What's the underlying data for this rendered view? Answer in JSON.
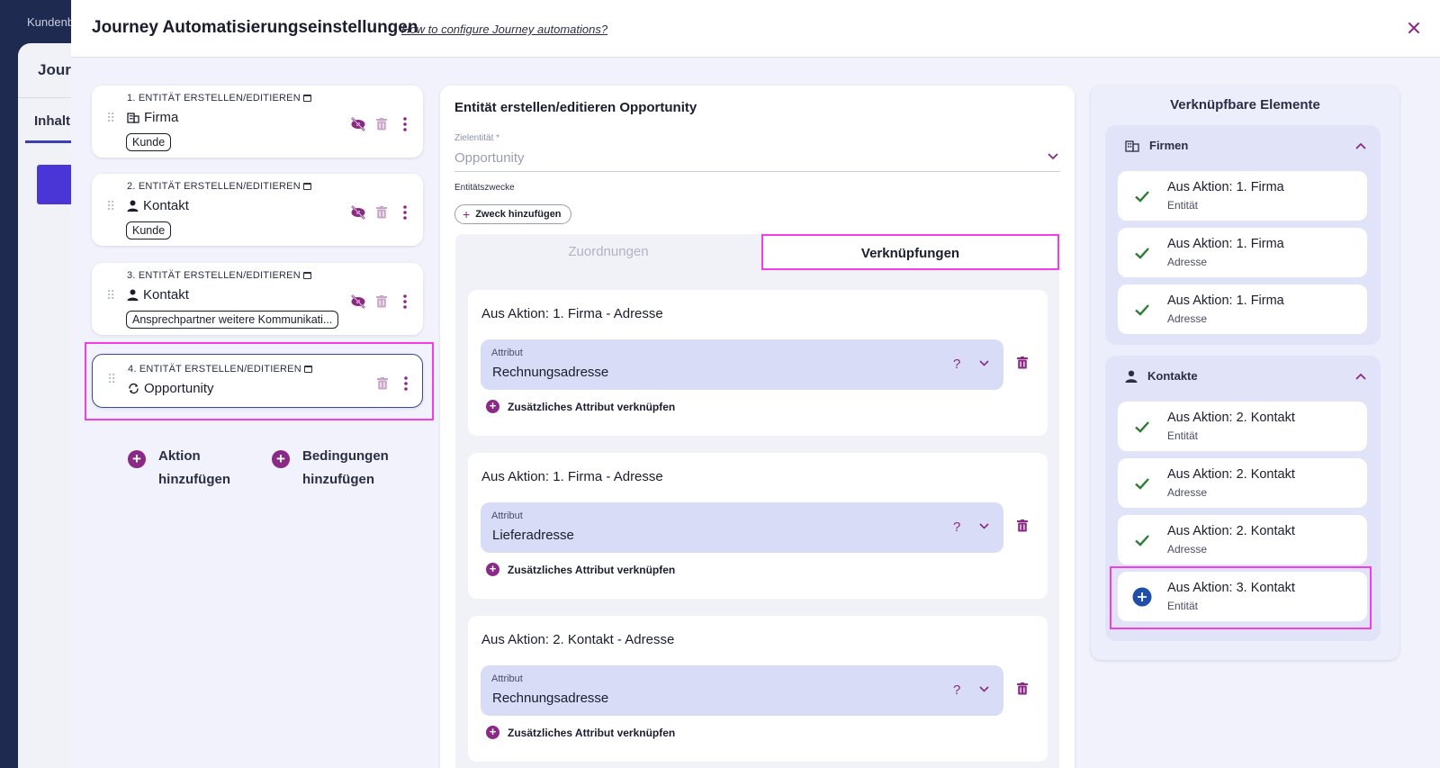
{
  "background": {
    "breadcrumb": "Kundenb",
    "card_title": "Jour",
    "tab": "Inhalt"
  },
  "modal": {
    "title": "Journey Automatisierungseinstellungen",
    "help_link": "How to configure Journey automations?",
    "close_label": "×"
  },
  "actions": [
    {
      "label": "1. ENTITÄT ERSTELLEN/EDITIEREN",
      "entity": "Firma",
      "entity_icon": "building-icon",
      "tag": "Kunde"
    },
    {
      "label": "2. ENTITÄT ERSTELLEN/EDITIEREN",
      "entity": "Kontakt",
      "entity_icon": "person-icon",
      "tag": "Kunde"
    },
    {
      "label": "3. ENTITÄT ERSTELLEN/EDITIEREN",
      "entity": "Kontakt",
      "entity_icon": "person-icon",
      "tag": "Ansprechpartner weitere Kommunikati..."
    },
    {
      "label": "4. ENTITÄT ERSTELLEN/EDITIEREN",
      "entity": "Opportunity",
      "entity_icon": "cycle-icon",
      "tag": ""
    }
  ],
  "add_buttons": {
    "action_line1": "Aktion",
    "action_line2": "hinzufügen",
    "condition_line1": "Bedingungen",
    "condition_line2": "hinzufügen"
  },
  "editor": {
    "title": "Entität erstellen/editieren Opportunity",
    "target_label": "Zielentität *",
    "target_value": "Opportunity",
    "purposes_label": "Entitätszwecke",
    "add_purpose": "Zweck hinzufügen",
    "tabs": {
      "mappings": "Zuordnungen",
      "links": "Verknüpfungen"
    },
    "links": [
      {
        "title": "Aus Aktion: 1. Firma - Adresse",
        "attr_label": "Attribut",
        "attr_value": "Rechnungsadresse",
        "add_label": "Zusätzliches Attribut verknüpfen"
      },
      {
        "title": "Aus Aktion: 1. Firma - Adresse",
        "attr_label": "Attribut",
        "attr_value": "Lieferadresse",
        "add_label": "Zusätzliches Attribut verknüpfen"
      },
      {
        "title": "Aus Aktion: 2. Kontakt - Adresse",
        "attr_label": "Attribut",
        "attr_value": "Rechnungsadresse",
        "add_label": "Zusätzliches Attribut verknüpfen"
      }
    ],
    "help_symbol": "?"
  },
  "linkable": {
    "title": "Verknüpfbare Elemente",
    "groups": [
      {
        "name": "Firmen",
        "icon": "building-icon",
        "items": [
          {
            "title": "Aus Aktion: 1. Firma",
            "sub": "Entität",
            "state": "linked"
          },
          {
            "title": "Aus Aktion: 1. Firma",
            "sub": "Adresse",
            "state": "linked"
          },
          {
            "title": "Aus Aktion: 1. Firma",
            "sub": "Adresse",
            "state": "linked"
          }
        ]
      },
      {
        "name": "Kontakte",
        "icon": "person-icon",
        "items": [
          {
            "title": "Aus Aktion: 2. Kontakt",
            "sub": "Entität",
            "state": "linked"
          },
          {
            "title": "Aus Aktion: 2. Kontakt",
            "sub": "Adresse",
            "state": "linked"
          },
          {
            "title": "Aus Aktion: 2. Kontakt",
            "sub": "Adresse",
            "state": "linked"
          },
          {
            "title": "Aus Aktion: 3. Kontakt",
            "sub": "Entität",
            "state": "add"
          }
        ]
      }
    ]
  },
  "colors": {
    "accent": "#8a2a86",
    "highlight": "#f23ee8",
    "check": "#2e7d32",
    "add_blue": "#1f4fa8"
  }
}
